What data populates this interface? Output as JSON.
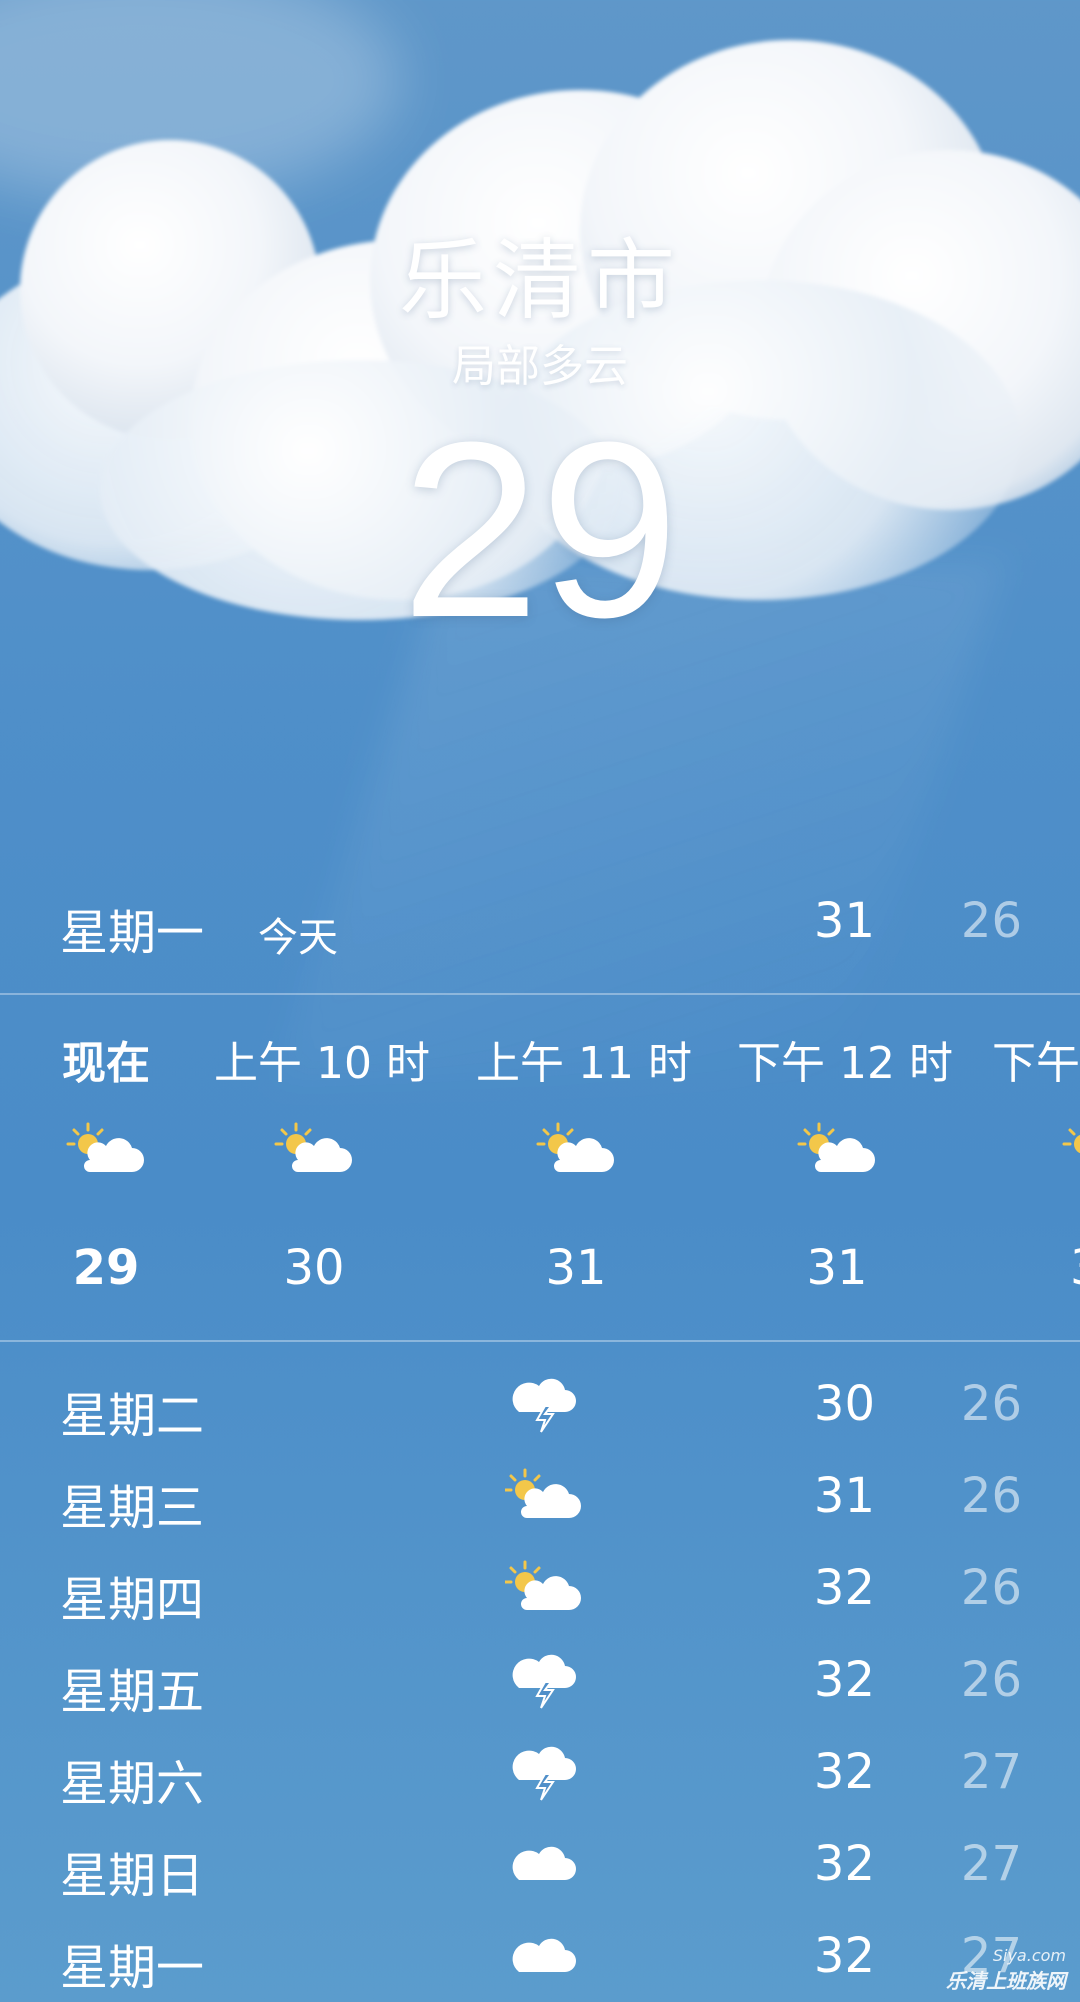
{
  "location": {
    "city": "乐清市",
    "condition": "局部多云",
    "current_temp": "29"
  },
  "today": {
    "day": "星期一",
    "label": "今天",
    "high": "31",
    "low": "26"
  },
  "hourly": [
    {
      "label": "现在",
      "icon": "partly-cloudy-day-icon",
      "temp": "29"
    },
    {
      "label": "上午 10 时",
      "icon": "partly-cloudy-day-icon",
      "temp": "30"
    },
    {
      "label": "上午 11 时",
      "icon": "partly-cloudy-day-icon",
      "temp": "31"
    },
    {
      "label": "下午 12 时",
      "icon": "partly-cloudy-day-icon",
      "temp": "31"
    },
    {
      "label": "下午",
      "icon": "partly-cloudy-day-icon",
      "temp": "3"
    }
  ],
  "daily": [
    {
      "day": "星期二",
      "icon": "thunderstorm-icon",
      "high": "30",
      "low": "26"
    },
    {
      "day": "星期三",
      "icon": "partly-cloudy-day-icon",
      "high": "31",
      "low": "26"
    },
    {
      "day": "星期四",
      "icon": "partly-cloudy-day-icon",
      "high": "32",
      "low": "26"
    },
    {
      "day": "星期五",
      "icon": "thunderstorm-icon",
      "high": "32",
      "low": "26"
    },
    {
      "day": "星期六",
      "icon": "thunderstorm-icon",
      "high": "32",
      "low": "27"
    },
    {
      "day": "星期日",
      "icon": "cloud-icon",
      "high": "32",
      "low": "27"
    },
    {
      "day": "星期一",
      "icon": "cloud-icon",
      "high": "32",
      "low": "27"
    }
  ],
  "watermark": {
    "logo": "Siya.com",
    "text": "乐清上班族网"
  },
  "colors": {
    "sky": "#4f8fc9",
    "sun": "#f3c74a",
    "cloud": "#ffffff",
    "low_temp": "rgba(255,255,255,0.55)"
  }
}
